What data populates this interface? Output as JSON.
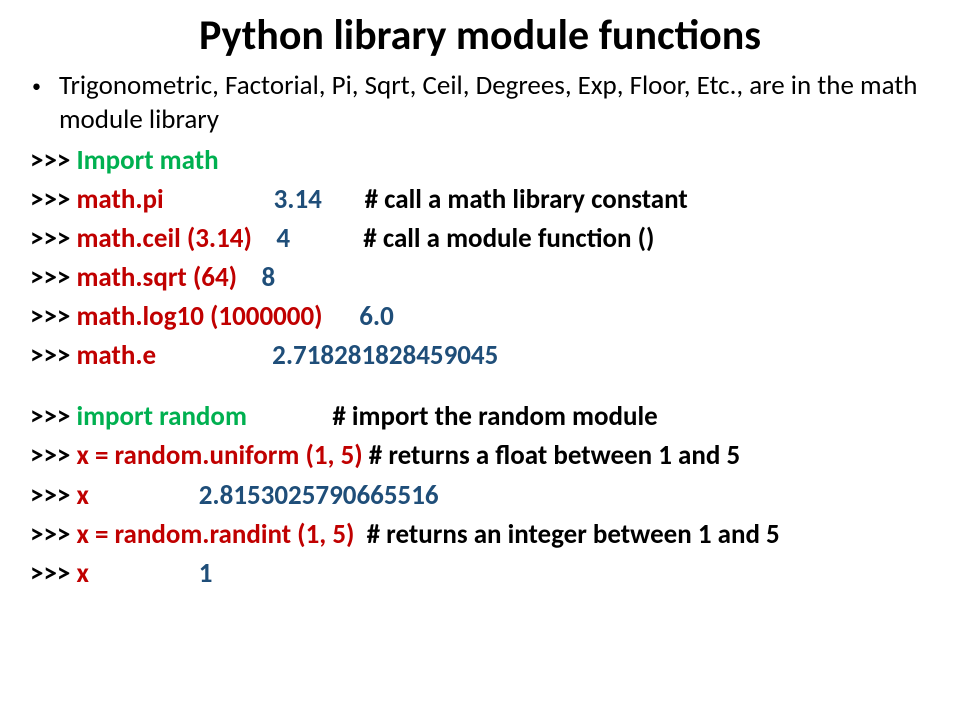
{
  "title": "Python library module functions",
  "bullet1": "Trigonometric, Factorial, Pi, Sqrt, Ceil, Degrees, Exp, Floor, Etc., are in the math module library",
  "p": ">>> ",
  "l1": {
    "cmd": "Import math"
  },
  "l2": {
    "cmd": "math.pi",
    "res": "3.14",
    "cmt": "# call a math library constant"
  },
  "l3": {
    "cmd": "math.ceil (3.14)",
    "res": "4",
    "cmt": "# call a module function ()"
  },
  "l4": {
    "cmd": "math.sqrt (64)",
    "res": "8"
  },
  "l5": {
    "cmd": "math.log10 (1000000)",
    "res": "6.0"
  },
  "l6": {
    "cmd": "math.e",
    "res": "2.718281828459045"
  },
  "l7": {
    "cmd": "import random",
    "cmt": "# import the random module"
  },
  "l8": {
    "cmd": "x = random.uniform (1, 5)",
    "cmt": " # returns a float between 1 and 5"
  },
  "l9": {
    "cmd": "x",
    "res": "2.8153025790665516"
  },
  "l10": {
    "cmd": "x = random.randint (1, 5)",
    "cmt": "  # returns an integer between 1 and 5"
  },
  "l11": {
    "cmd": "x",
    "res": "1"
  }
}
